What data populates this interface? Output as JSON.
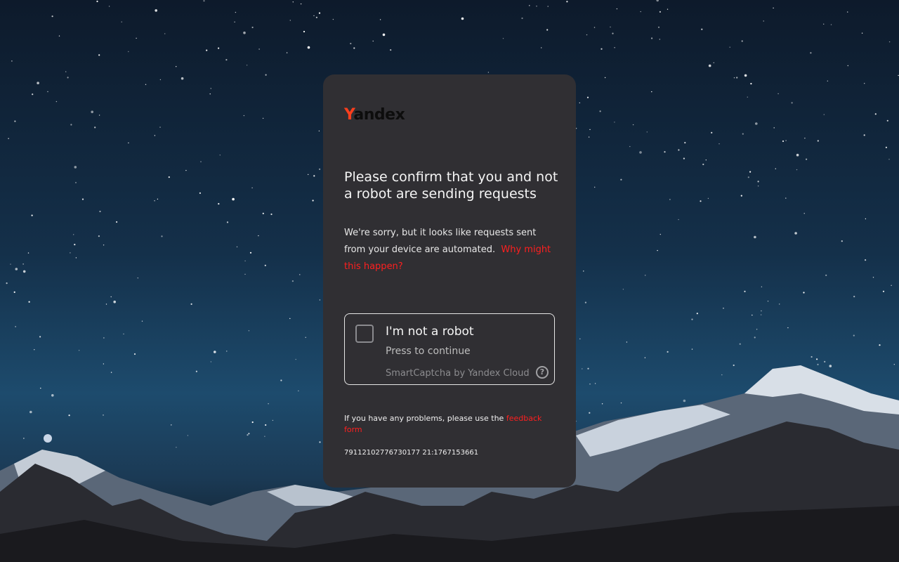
{
  "brand": {
    "logo_first": "Y",
    "logo_rest": "andex"
  },
  "page": {
    "title": "Please confirm that you and not a robot are sending requests",
    "description": "We're sorry, but it looks like requests sent from your device are automated.",
    "why_link": "Why might this happen?"
  },
  "captcha": {
    "label": "I'm not a robot",
    "sublabel": "Press to continue",
    "provider": "SmartCaptcha by Yandex Cloud",
    "help_icon": "?"
  },
  "footer": {
    "problems_text": "If you have any problems, please use the",
    "feedback_link": "feedback form",
    "request_id": "79112102776730177 21:1767153661"
  },
  "colors": {
    "accent": "#ff1f1f",
    "card": "#302f33",
    "logo_y": "#fc3f1d"
  }
}
